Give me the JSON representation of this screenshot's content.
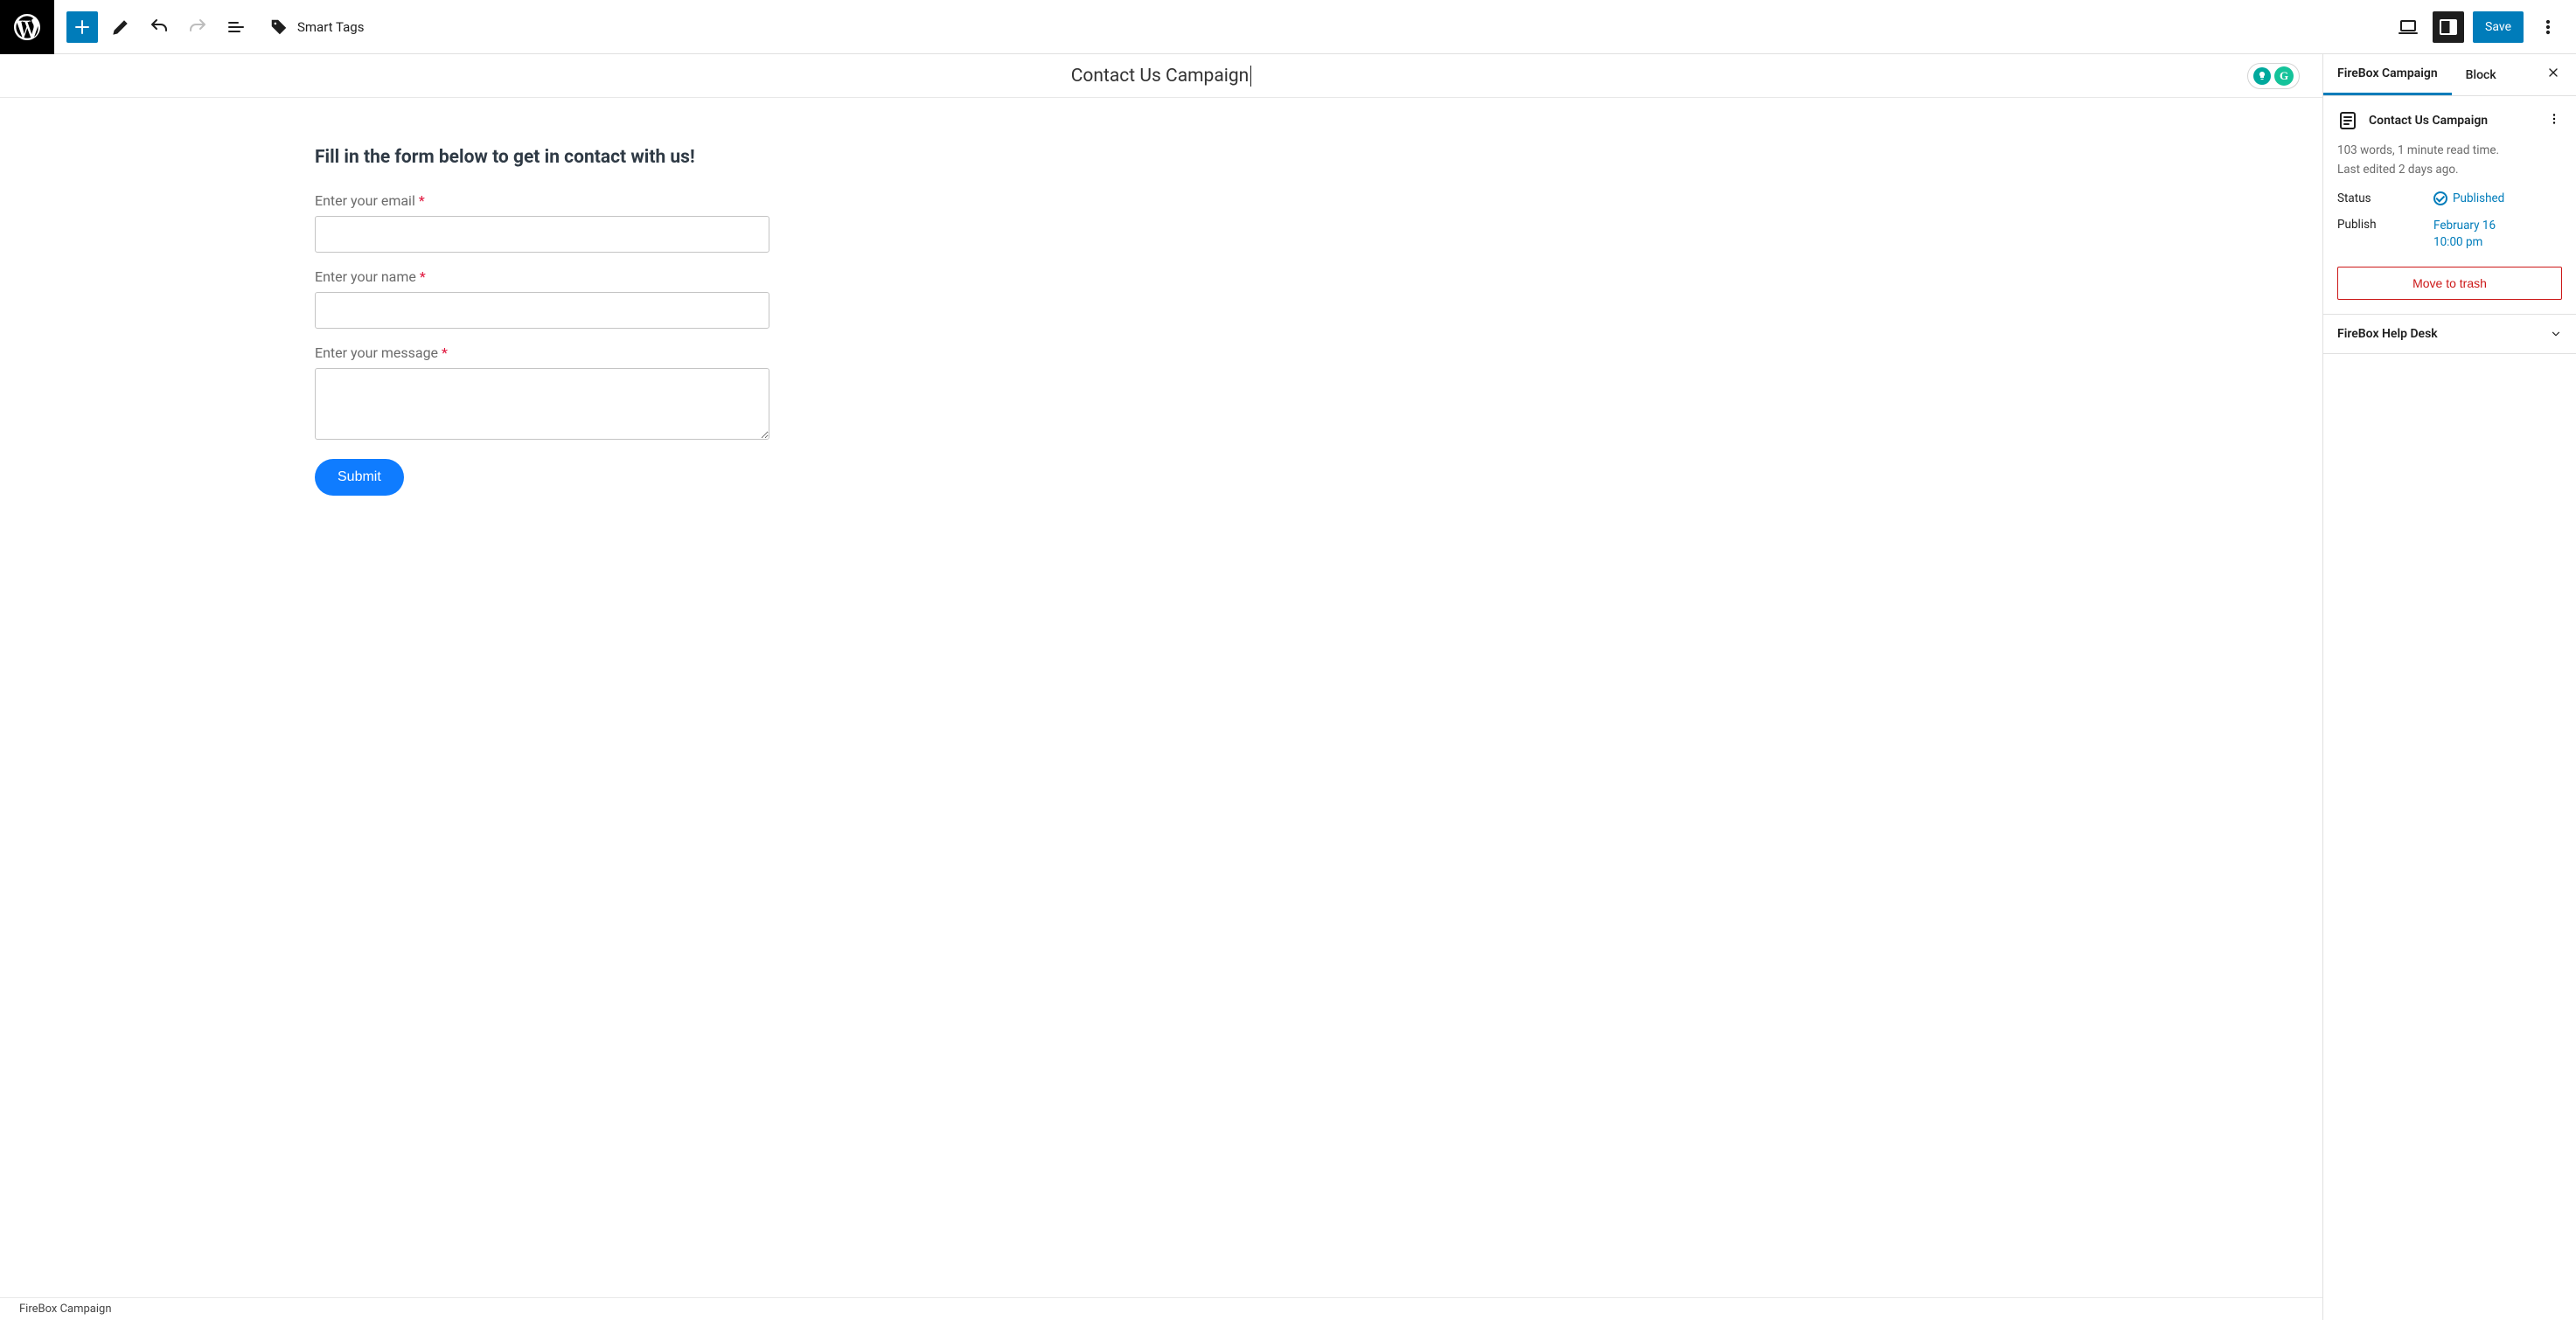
{
  "toolbar": {
    "smart_tags_label": "Smart Tags",
    "save_label": "Save"
  },
  "post": {
    "title": "Contact Us Campaign"
  },
  "form": {
    "heading": "Fill in the form below to get in contact with us!",
    "email_label": "Enter your email",
    "name_label": "Enter your name",
    "message_label": "Enter your message",
    "submit_label": "Submit"
  },
  "sidebar": {
    "tabs": {
      "campaign": "FireBox Campaign",
      "block": "Block"
    },
    "doc_title": "Contact Us Campaign",
    "meta_words": "103 words, 1 minute read time.",
    "meta_edited": "Last edited 2 days ago.",
    "status_label": "Status",
    "status_value": "Published",
    "publish_label": "Publish",
    "publish_date": "February 16",
    "publish_time": "10:00 pm",
    "trash_label": "Move to trash",
    "help_desk_label": "FireBox Help Desk"
  },
  "footer": {
    "breadcrumb": "FireBox Campaign"
  },
  "assist": {
    "grammarly_glyph": "G"
  }
}
